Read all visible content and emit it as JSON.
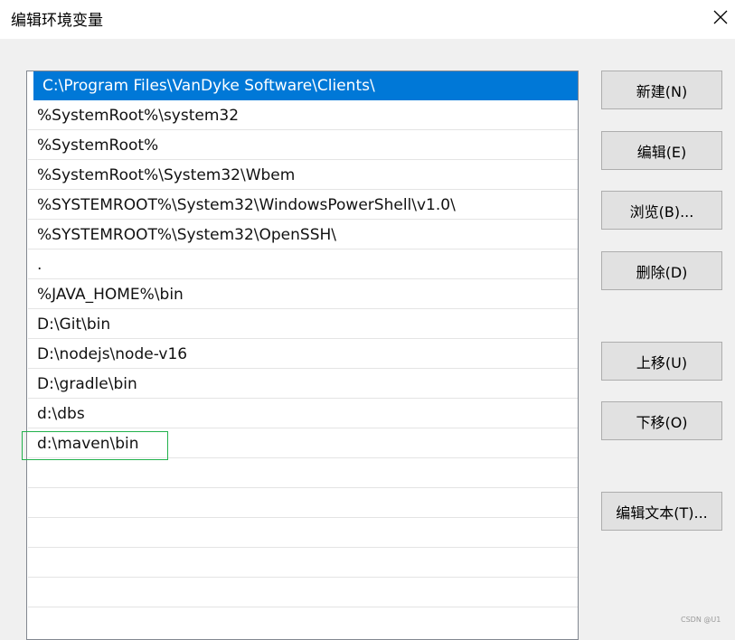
{
  "window": {
    "title": "编辑环境变量",
    "close_icon": "close-icon"
  },
  "path_list": {
    "items": [
      "C:\\Program Files\\VanDyke Software\\Clients\\",
      "%SystemRoot%\\system32",
      "%SystemRoot%",
      "%SystemRoot%\\System32\\Wbem",
      "%SYSTEMROOT%\\System32\\WindowsPowerShell\\v1.0\\",
      "%SYSTEMROOT%\\System32\\OpenSSH\\",
      ".",
      "%JAVA_HOME%\\bin",
      "D:\\Git\\bin",
      "D:\\nodejs\\node-v16",
      "D:\\gradle\\bin",
      "d:\\dbs",
      "d:\\maven\\bin"
    ],
    "selected_index": 0,
    "selection_color": "#0078d7",
    "highlight_color": "#22b14c"
  },
  "buttons": {
    "new": "新建(N)",
    "edit": "编辑(E)",
    "browse": "浏览(B)...",
    "delete": "删除(D)",
    "move_up": "上移(U)",
    "move_down": "下移(O)",
    "edit_text": "编辑文本(T)..."
  },
  "watermark": "CSDN @U1"
}
